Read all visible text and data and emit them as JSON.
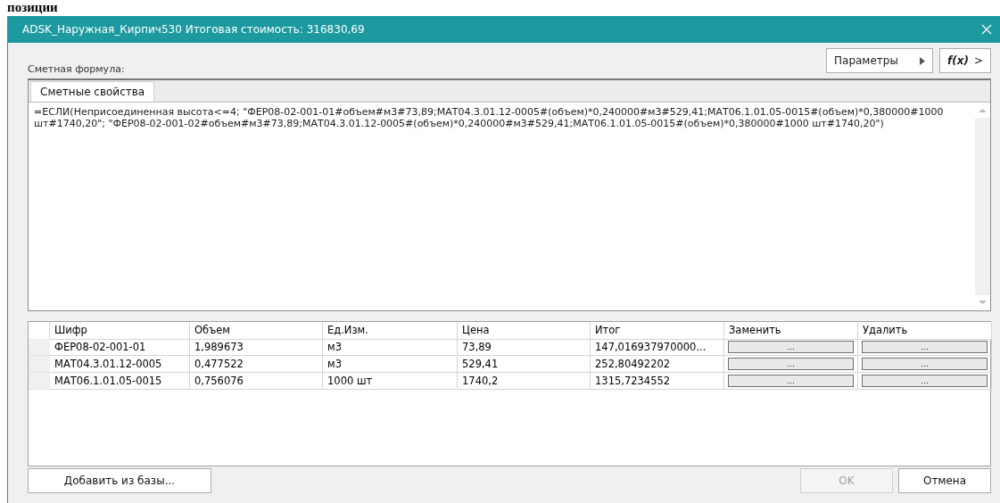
{
  "page_caption": "позиции",
  "window": {
    "title": "ADSK_Наружная_Кирпич530 Итоговая стоимость: 316830,69"
  },
  "formula_label": "Сметная формула:",
  "top_buttons": [
    {
      "label": "Параметры",
      "kind": "menu"
    },
    {
      "label": "f(x)",
      "kind": "expand",
      "suffix": ">"
    }
  ],
  "tabs": [
    {
      "label": "Сметные свойства",
      "selected": true
    }
  ],
  "formula": "=ЕСЛИ(Неприсоединенная высота<=4; \"ФЕР08-02-001-01#объем#м3#73,89;МАТ04.3.01.12-0005#(объем)*0,240000#м3#529,41;МАТ06.1.01.05-0015#(объем)*0,380000#1000 шт#1740,20\"; \"ФЕР08-02-001-02#объем#м3#73,89;МАТ04.3.01.12-0005#(объем)*0,240000#м3#529,41;МАТ06.1.01.05-0015#(объем)*0,380000#1000 шт#1740,20\")",
  "table": {
    "columns": [
      "Шифр",
      "Объем",
      "Ед.Изм.",
      "Цена",
      "Итог",
      "Заменить",
      "Удалить"
    ],
    "rows": [
      {
        "cells": [
          "ФЕР08-02-001-01",
          "1,989673",
          "м3",
          "73,89",
          "147,016937970000..."
        ],
        "actions": [
          "...",
          "..."
        ]
      },
      {
        "cells": [
          "МАТ04.3.01.12-0005",
          "0,477522",
          "м3",
          "529,41",
          "252,80492202"
        ],
        "actions": [
          "...",
          "..."
        ]
      },
      {
        "cells": [
          "МАТ06.1.01.05-0015",
          "0,756076",
          "1000 шт",
          "1740,2",
          "1315,7234552"
        ],
        "actions": [
          "...",
          "..."
        ]
      }
    ]
  },
  "add_button": {
    "label": "Добавить из базы...",
    "disabled": false
  },
  "dialog_buttons": [
    {
      "label": "OK",
      "disabled": true
    },
    {
      "label": "Отмена",
      "disabled": false
    }
  ]
}
